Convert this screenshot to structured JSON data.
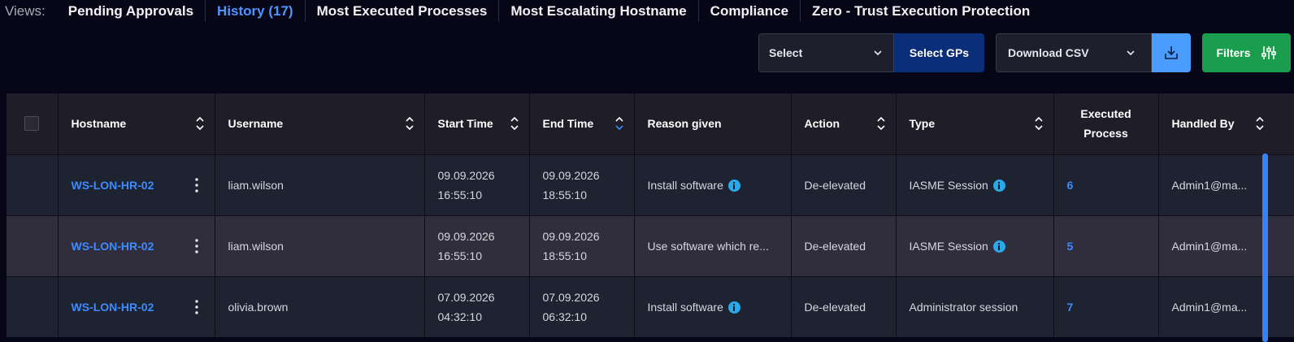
{
  "views": {
    "label": "Views:",
    "tabs": [
      {
        "label": "Pending Approvals",
        "active": false
      },
      {
        "label": "History (17)",
        "active": true
      },
      {
        "label": "Most Executed Processes",
        "active": false
      },
      {
        "label": "Most Escalating Hostname",
        "active": false
      },
      {
        "label": "Compliance",
        "active": false
      },
      {
        "label": "Zero - Trust Execution Protection",
        "active": false
      }
    ]
  },
  "toolbar": {
    "select_value": "Select",
    "select_gps_label": "Select GPs",
    "download_value": "Download CSV",
    "download_icon": "download-icon",
    "filters_label": "Filters",
    "filters_icon": "sliders-icon"
  },
  "table": {
    "columns": [
      "Hostname",
      "Username",
      "Start Time",
      "End Time",
      "Reason given",
      "Action",
      "Type",
      "Executed Process",
      "Handled By"
    ],
    "rows": [
      {
        "hostname": "WS-LON-HR-02",
        "username": "liam.wilson",
        "start_date": "09.09.2026",
        "start_time": "16:55:10",
        "end_date": "09.09.2026",
        "end_time": "18:55:10",
        "reason": "Install software",
        "action": "De-elevated",
        "type": "IASME Session",
        "executed": "6",
        "handled_by": "Admin1@ma..."
      },
      {
        "hostname": "WS-LON-HR-02",
        "username": "liam.wilson",
        "start_date": "09.09.2026",
        "start_time": "16:55:10",
        "end_date": "09.09.2026",
        "end_time": "18:55:10",
        "reason": "Use software which re...",
        "action": "De-elevated",
        "type": "IASME Session",
        "executed": "5",
        "handled_by": "Admin1@ma..."
      },
      {
        "hostname": "WS-LON-HR-02",
        "username": "olivia.brown",
        "start_date": "07.09.2026",
        "start_time": "04:32:10",
        "end_date": "07.09.2026",
        "end_time": "06:32:10",
        "reason": "Install software",
        "action": "De-elevated",
        "type": "Administrator session",
        "executed": "7",
        "handled_by": "Admin1@ma..."
      }
    ]
  },
  "colors": {
    "accent": "#4f95ff",
    "link": "#3d8bff",
    "select_gps_bg": "#0b2e78",
    "download_bg": "#4a9cff",
    "filters_bg": "#1a9e4e"
  }
}
